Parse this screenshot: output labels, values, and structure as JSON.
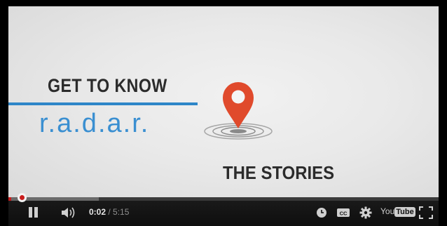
{
  "video": {
    "headline": "GET TO KNOW",
    "brand": "r.a.d.a.r.",
    "tagline": "THE STORIES"
  },
  "player": {
    "progress_fraction": 0.0063,
    "buffered_fraction": 0.21,
    "current_time": "0:02",
    "separator": " / ",
    "duration": "5:15",
    "youtube_label_a": "You",
    "youtube_label_b": "Tube"
  },
  "icons": {
    "pause": "pause-icon",
    "volume": "volume-icon",
    "clock": "watch-later-icon",
    "cc": "captions-icon",
    "settings": "gear-icon",
    "fullscreen": "fullscreen-icon",
    "pin": "location-pin-icon"
  },
  "colors": {
    "accent_red": "#c91d1d",
    "brand_blue": "#3a8fd1",
    "pin_red": "#e04a2c"
  }
}
